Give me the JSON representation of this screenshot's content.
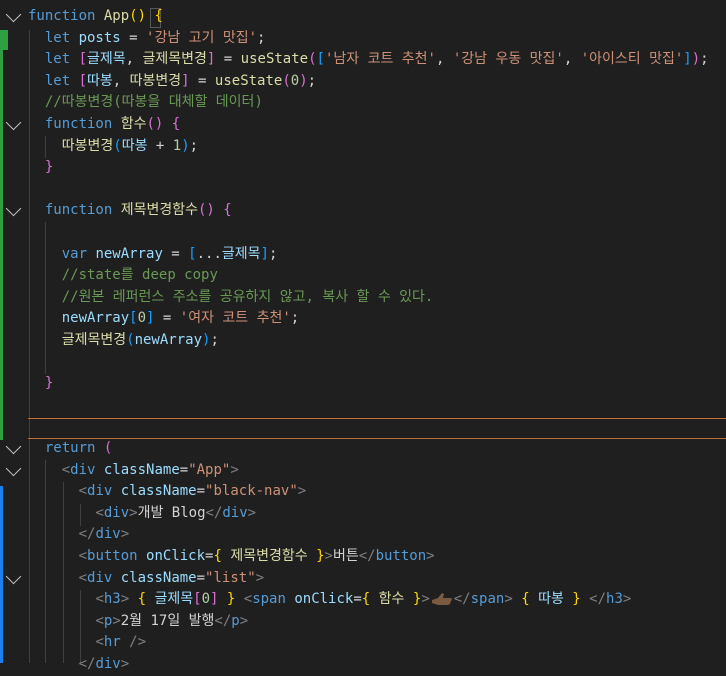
{
  "editor": {
    "lines": [
      [
        [
          "kw",
          "function "
        ],
        [
          "fn",
          "App"
        ],
        [
          "p1",
          "()"
        ],
        [
          "txt",
          " "
        ],
        [
          "p1",
          "{"
        ]
      ],
      [
        [
          "txt",
          "  "
        ],
        [
          "kw",
          "let "
        ],
        [
          "var",
          "posts"
        ],
        [
          "txt",
          " = "
        ],
        [
          "str",
          "'강남 고기 맛집'"
        ],
        [
          "txt",
          ";"
        ]
      ],
      [
        [
          "txt",
          "  "
        ],
        [
          "kw",
          "let "
        ],
        [
          "p2",
          "["
        ],
        [
          "var",
          "글제목"
        ],
        [
          "txt",
          ", "
        ],
        [
          "fn",
          "글제목변경"
        ],
        [
          "p2",
          "]"
        ],
        [
          "txt",
          " = "
        ],
        [
          "fn",
          "useState"
        ],
        [
          "p2",
          "("
        ],
        [
          "p3",
          "["
        ],
        [
          "str",
          "'남자 코트 추천'"
        ],
        [
          "txt",
          ", "
        ],
        [
          "str",
          "'강남 우동 맛집'"
        ],
        [
          "txt",
          ", "
        ],
        [
          "str",
          "'아이스티 맛집'"
        ],
        [
          "p3",
          "]"
        ],
        [
          "p2",
          ")"
        ],
        [
          "txt",
          ";"
        ]
      ],
      [
        [
          "txt",
          "  "
        ],
        [
          "kw",
          "let "
        ],
        [
          "p2",
          "["
        ],
        [
          "var",
          "따봉"
        ],
        [
          "txt",
          ", "
        ],
        [
          "fn",
          "따봉변경"
        ],
        [
          "p2",
          "]"
        ],
        [
          "txt",
          " = "
        ],
        [
          "fn",
          "useState"
        ],
        [
          "p2",
          "("
        ],
        [
          "num",
          "0"
        ],
        [
          "p2",
          ")"
        ],
        [
          "txt",
          ";"
        ]
      ],
      [
        [
          "txt",
          "  "
        ],
        [
          "com",
          "//따봉변경(따봉을 대체할 데이터)"
        ]
      ],
      [
        [
          "txt",
          "  "
        ],
        [
          "kw",
          "function "
        ],
        [
          "fn",
          "함수"
        ],
        [
          "p2",
          "()"
        ],
        [
          "txt",
          " "
        ],
        [
          "p2",
          "{"
        ]
      ],
      [
        [
          "txt",
          "    "
        ],
        [
          "fn",
          "따봉변경"
        ],
        [
          "p3",
          "("
        ],
        [
          "var",
          "따봉"
        ],
        [
          "txt",
          " + "
        ],
        [
          "num",
          "1"
        ],
        [
          "p3",
          ")"
        ],
        [
          "txt",
          ";"
        ]
      ],
      [
        [
          "txt",
          "  "
        ],
        [
          "p2",
          "}"
        ]
      ],
      [],
      [
        [
          "txt",
          "  "
        ],
        [
          "kw",
          "function "
        ],
        [
          "fn",
          "제목변경함수"
        ],
        [
          "p2",
          "()"
        ],
        [
          "txt",
          " "
        ],
        [
          "p2",
          "{"
        ]
      ],
      [],
      [
        [
          "txt",
          "    "
        ],
        [
          "kw",
          "var "
        ],
        [
          "var",
          "newArray"
        ],
        [
          "txt",
          " = "
        ],
        [
          "p3",
          "["
        ],
        [
          "txt",
          "..."
        ],
        [
          "var",
          "글제목"
        ],
        [
          "p3",
          "]"
        ],
        [
          "txt",
          ";"
        ]
      ],
      [
        [
          "txt",
          "    "
        ],
        [
          "com",
          "//state를 deep copy"
        ]
      ],
      [
        [
          "txt",
          "    "
        ],
        [
          "com",
          "//원본 레퍼런스 주소를 공유하지 않고, 복사 할 수 있다."
        ]
      ],
      [
        [
          "txt",
          "    "
        ],
        [
          "var",
          "newArray"
        ],
        [
          "p3",
          "["
        ],
        [
          "num",
          "0"
        ],
        [
          "p3",
          "]"
        ],
        [
          "txt",
          " = "
        ],
        [
          "str",
          "'여자 코트 추천'"
        ],
        [
          "txt",
          ";"
        ]
      ],
      [
        [
          "txt",
          "    "
        ],
        [
          "fn",
          "글제목변경"
        ],
        [
          "p3",
          "("
        ],
        [
          "var",
          "newArray"
        ],
        [
          "p3",
          ")"
        ],
        [
          "txt",
          ";"
        ]
      ],
      [],
      [
        [
          "txt",
          "  "
        ],
        [
          "p2",
          "}"
        ]
      ],
      [],
      [],
      [
        [
          "txt",
          "  "
        ],
        [
          "kw",
          "return "
        ],
        [
          "p2",
          "("
        ]
      ],
      [
        [
          "txt",
          "    "
        ],
        [
          "ang",
          "<"
        ],
        [
          "tag",
          "div"
        ],
        [
          "txt",
          " "
        ],
        [
          "attr",
          "className"
        ],
        [
          "txt",
          "="
        ],
        [
          "str",
          "\"App\""
        ],
        [
          "ang",
          ">"
        ]
      ],
      [
        [
          "txt",
          "      "
        ],
        [
          "ang",
          "<"
        ],
        [
          "tag",
          "div"
        ],
        [
          "txt",
          " "
        ],
        [
          "attr",
          "className"
        ],
        [
          "txt",
          "="
        ],
        [
          "str",
          "\"black-nav\""
        ],
        [
          "ang",
          ">"
        ]
      ],
      [
        [
          "txt",
          "        "
        ],
        [
          "ang",
          "<"
        ],
        [
          "tag",
          "div"
        ],
        [
          "ang",
          ">"
        ],
        [
          "txt",
          "개발 Blog"
        ],
        [
          "ang",
          "</"
        ],
        [
          "tag",
          "div"
        ],
        [
          "ang",
          ">"
        ]
      ],
      [
        [
          "txt",
          "      "
        ],
        [
          "ang",
          "</"
        ],
        [
          "tag",
          "div"
        ],
        [
          "ang",
          ">"
        ]
      ],
      [
        [
          "txt",
          "      "
        ],
        [
          "ang",
          "<"
        ],
        [
          "tag",
          "button"
        ],
        [
          "txt",
          " "
        ],
        [
          "attr",
          "onClick"
        ],
        [
          "txt",
          "="
        ],
        [
          "p1",
          "{"
        ],
        [
          "txt",
          " "
        ],
        [
          "fn",
          "제목변경함수"
        ],
        [
          "txt",
          " "
        ],
        [
          "p1",
          "}"
        ],
        [
          "ang",
          ">"
        ],
        [
          "txt",
          "버튼"
        ],
        [
          "ang",
          "</"
        ],
        [
          "tag",
          "button"
        ],
        [
          "ang",
          ">"
        ]
      ],
      [
        [
          "txt",
          "      "
        ],
        [
          "ang",
          "<"
        ],
        [
          "tag",
          "div"
        ],
        [
          "txt",
          " "
        ],
        [
          "attr",
          "className"
        ],
        [
          "txt",
          "="
        ],
        [
          "str",
          "\"list\""
        ],
        [
          "ang",
          ">"
        ]
      ],
      [
        [
          "txt",
          "        "
        ],
        [
          "ang",
          "<"
        ],
        [
          "tag",
          "h3"
        ],
        [
          "ang",
          ">"
        ],
        [
          "txt",
          " "
        ],
        [
          "p1",
          "{"
        ],
        [
          "txt",
          " "
        ],
        [
          "var",
          "글제목"
        ],
        [
          "p2",
          "["
        ],
        [
          "num",
          "0"
        ],
        [
          "p2",
          "]"
        ],
        [
          "txt",
          " "
        ],
        [
          "p1",
          "}"
        ],
        [
          "txt",
          " "
        ],
        [
          "ang",
          "<"
        ],
        [
          "tag",
          "span"
        ],
        [
          "txt",
          " "
        ],
        [
          "attr",
          "onClick"
        ],
        [
          "txt",
          "="
        ],
        [
          "p1",
          "{"
        ],
        [
          "txt",
          " "
        ],
        [
          "fn",
          "함수"
        ],
        [
          "txt",
          " "
        ],
        [
          "p1",
          "}"
        ],
        [
          "ang",
          ">"
        ],
        [
          "emoji",
          "thumbs-up"
        ],
        [
          "ang",
          "</"
        ],
        [
          "tag",
          "span"
        ],
        [
          "ang",
          ">"
        ],
        [
          "txt",
          " "
        ],
        [
          "p1",
          "{"
        ],
        [
          "txt",
          " "
        ],
        [
          "var",
          "따봉"
        ],
        [
          "txt",
          " "
        ],
        [
          "p1",
          "}"
        ],
        [
          "txt",
          " "
        ],
        [
          "ang",
          "</"
        ],
        [
          "tag",
          "h3"
        ],
        [
          "ang",
          ">"
        ]
      ],
      [
        [
          "txt",
          "        "
        ],
        [
          "ang",
          "<"
        ],
        [
          "tag",
          "p"
        ],
        [
          "ang",
          ">"
        ],
        [
          "txt",
          "2월 17일 발행"
        ],
        [
          "ang",
          "</"
        ],
        [
          "tag",
          "p"
        ],
        [
          "ang",
          ">"
        ]
      ],
      [
        [
          "txt",
          "        "
        ],
        [
          "ang",
          "<"
        ],
        [
          "tag",
          "hr"
        ],
        [
          "txt",
          " "
        ],
        [
          "ang",
          "/>"
        ]
      ],
      [
        [
          "txt",
          "      "
        ],
        [
          "ang",
          "</"
        ],
        [
          "tag",
          "div"
        ],
        [
          "ang",
          ">"
        ]
      ]
    ],
    "folded_lines": [
      0,
      5,
      9,
      20,
      21,
      26
    ],
    "colors": {
      "background": "#1f1f1f",
      "keyword": "#569cd6",
      "function": "#dcdcaa",
      "variable": "#9cdcfe",
      "string": "#ce9178",
      "number": "#b5cea8",
      "comment": "#6a9955",
      "bracket_1": "#ffd700",
      "bracket_2": "#da70d6",
      "bracket_3": "#179fff",
      "git_added": "#2ea043",
      "git_modified": "#1b81f0",
      "current_line_border": "#c0703a"
    }
  }
}
